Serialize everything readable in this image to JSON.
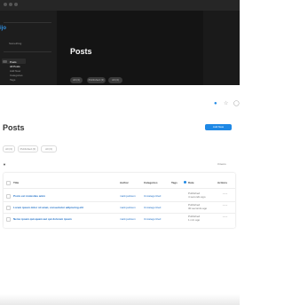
{
  "app": {
    "logo_text": "ijo"
  },
  "sidebar": {
    "site_name": "Something",
    "items": [
      {
        "label": "Posts"
      },
      {
        "label": "All Posts"
      },
      {
        "label": "Add New"
      },
      {
        "label": "Categories"
      },
      {
        "label": "Tags"
      }
    ]
  },
  "dark_header": {
    "title": "Posts",
    "tabs": [
      {
        "label": "All (3)"
      },
      {
        "label": "Published (3)"
      },
      {
        "label": "All (3)"
      }
    ]
  },
  "header_icons": [
    "bell-icon",
    "star-icon",
    "user-icon"
  ],
  "page": {
    "title": "Posts",
    "add_button": "Add New",
    "tabs": [
      {
        "label": "All (3)"
      },
      {
        "label": "Published (3)"
      },
      {
        "label": "All (3)"
      }
    ],
    "filter_icon": "filter-icon",
    "item_count": "3 items"
  },
  "table": {
    "columns": [
      "Title",
      "Author",
      "Categories",
      "Tags",
      "Date",
      "Actions"
    ],
    "rows": [
      {
        "title": "Posts est molestias anim",
        "author": "mark.jackson",
        "category": "Uncategorized",
        "date1": "Published",
        "date2": "4 seconds ago"
      },
      {
        "title": "Lorem ipsum dolor sit amet, consectetur adipiscing elit",
        "author": "mark.jackson",
        "category": "Uncategorized",
        "date1": "Published",
        "date2": "30 seconds ago"
      },
      {
        "title": "Nemo ipsam quisquam aut qui dolorem ipsam",
        "author": "mark.jackson",
        "category": "Uncategorized",
        "date1": "Published",
        "date2": "1 min ago"
      }
    ]
  },
  "colors": {
    "accent": "#1e88e5",
    "dark_bg": "#141414",
    "sidebar_bg": "#1d1d1d"
  }
}
